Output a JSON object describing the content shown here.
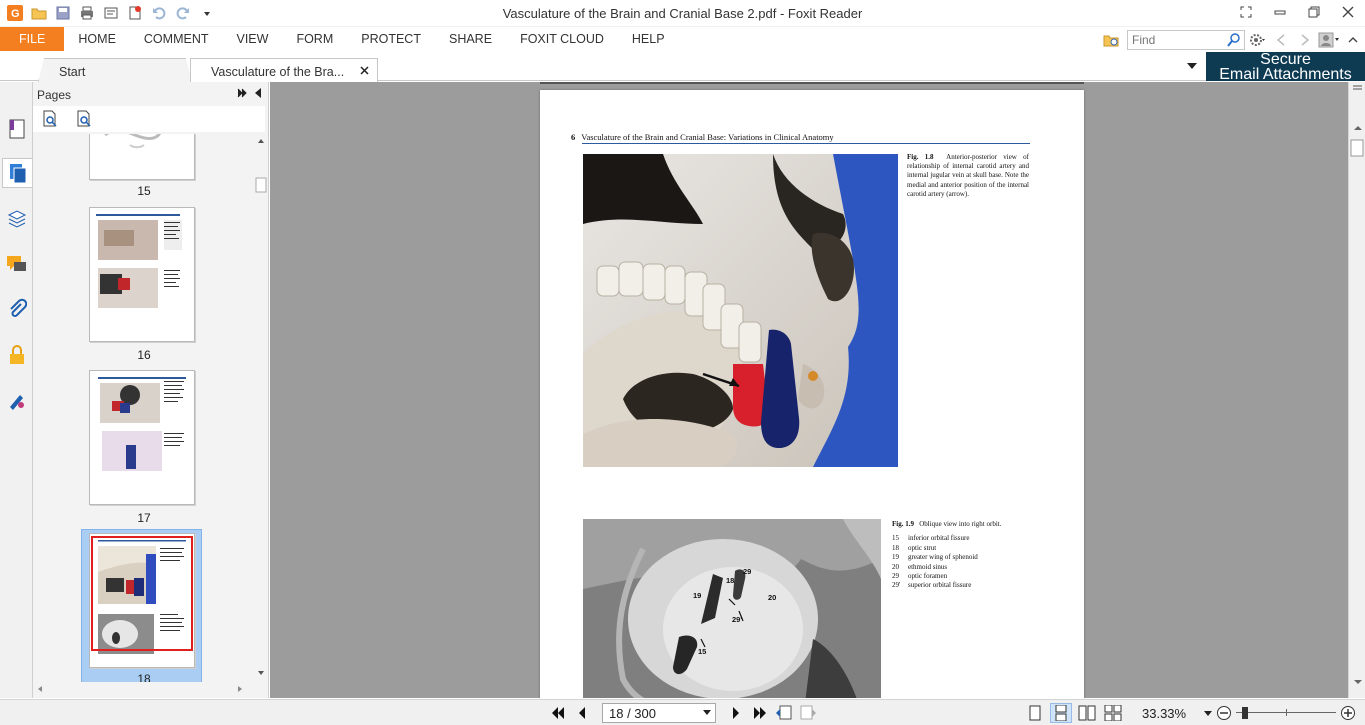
{
  "window": {
    "title": "Vasculature of the Brain and Cranial Base 2.pdf - Foxit Reader"
  },
  "ribbon": {
    "tabs": [
      "FILE",
      "HOME",
      "COMMENT",
      "VIEW",
      "FORM",
      "PROTECT",
      "SHARE",
      "FOXIT CLOUD",
      "HELP"
    ],
    "find_placeholder": "Find"
  },
  "doc_tabs": {
    "start": "Start",
    "active": "Vasculature of the Bra..."
  },
  "ad": {
    "line1": "Secure",
    "line2": "Email Attachments"
  },
  "pages_panel": {
    "title": "Pages",
    "thumbs": [
      {
        "label": "15"
      },
      {
        "label": "16"
      },
      {
        "label": "17"
      },
      {
        "label": "18",
        "selected": true
      }
    ]
  },
  "document": {
    "page_number": "6",
    "running_head": "Vasculature of the Brain and Cranial Base: Variations in Clinical Anatomy",
    "fig1_caption_label": "Fig. 1.8",
    "fig1_caption": "Anterior-posterior view of relationship of internal carotid artery and internal jugular vein at skull base. Note the medial and anterior position of the internal carotid artery (arrow).",
    "fig2_caption_label": "Fig. 1.9",
    "fig2_caption": "Oblique view into right orbit.",
    "fig2_legend": [
      {
        "num": "15",
        "text": "inferior orbital fissure"
      },
      {
        "num": "18",
        "text": "optic strut"
      },
      {
        "num": "19",
        "text": "greater wing of sphenoid"
      },
      {
        "num": "20",
        "text": "ethmoid sinus"
      },
      {
        "num": "29",
        "text": "optic foramen"
      },
      {
        "num": "29'",
        "text": "superior orbital fissure"
      }
    ],
    "fig2_labels": [
      "19",
      "18",
      "29",
      "20",
      "29'",
      "15"
    ]
  },
  "status": {
    "page_field": "18 / 300",
    "zoom": "33.33%"
  },
  "colors": {
    "file_tab": "#f47f20",
    "ad_bg": "#0e3a52",
    "selection": "#a9cdf3",
    "doc_bg": "#9c9c9c",
    "thumb_highlight": "#e0201e"
  }
}
